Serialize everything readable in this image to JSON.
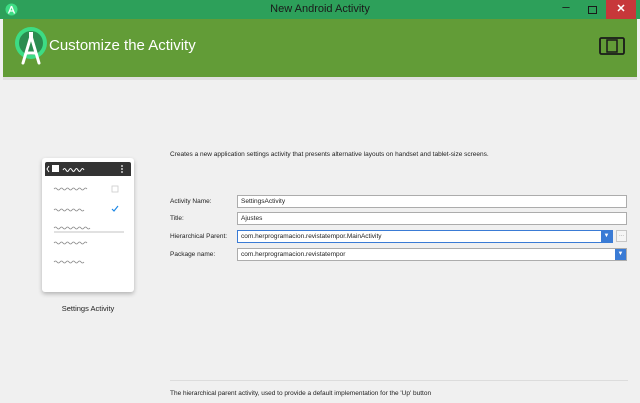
{
  "window": {
    "title": "New Android Activity",
    "minimize_glyph": "–",
    "close_glyph": "✕"
  },
  "header": {
    "title": "Customize the Activity",
    "logo_icon": "android-studio-icon",
    "device_icon": "phone-tablet-icon",
    "brand_color": "#629c37"
  },
  "preview": {
    "label": "Settings Activity",
    "check_color": "#1e88e5"
  },
  "description": "Creates a new application settings activity that presents alternative layouts on handset and tablet-size screens.",
  "form": {
    "activity_name": {
      "label": "Activity Name:",
      "value": "SettingsActivity"
    },
    "title": {
      "label": "Title:",
      "value": "Ajustes"
    },
    "hierarchical_parent": {
      "label": "Hierarchical Parent:",
      "value": "com.herprogramacion.revistatempor.MainActivity",
      "more_label": "..."
    },
    "package_name": {
      "label": "Package name:",
      "value": "com.herprogramacion.revistatempor"
    }
  },
  "help_text": "The hierarchical parent activity, used to provide a default implementation for the 'Up' button"
}
